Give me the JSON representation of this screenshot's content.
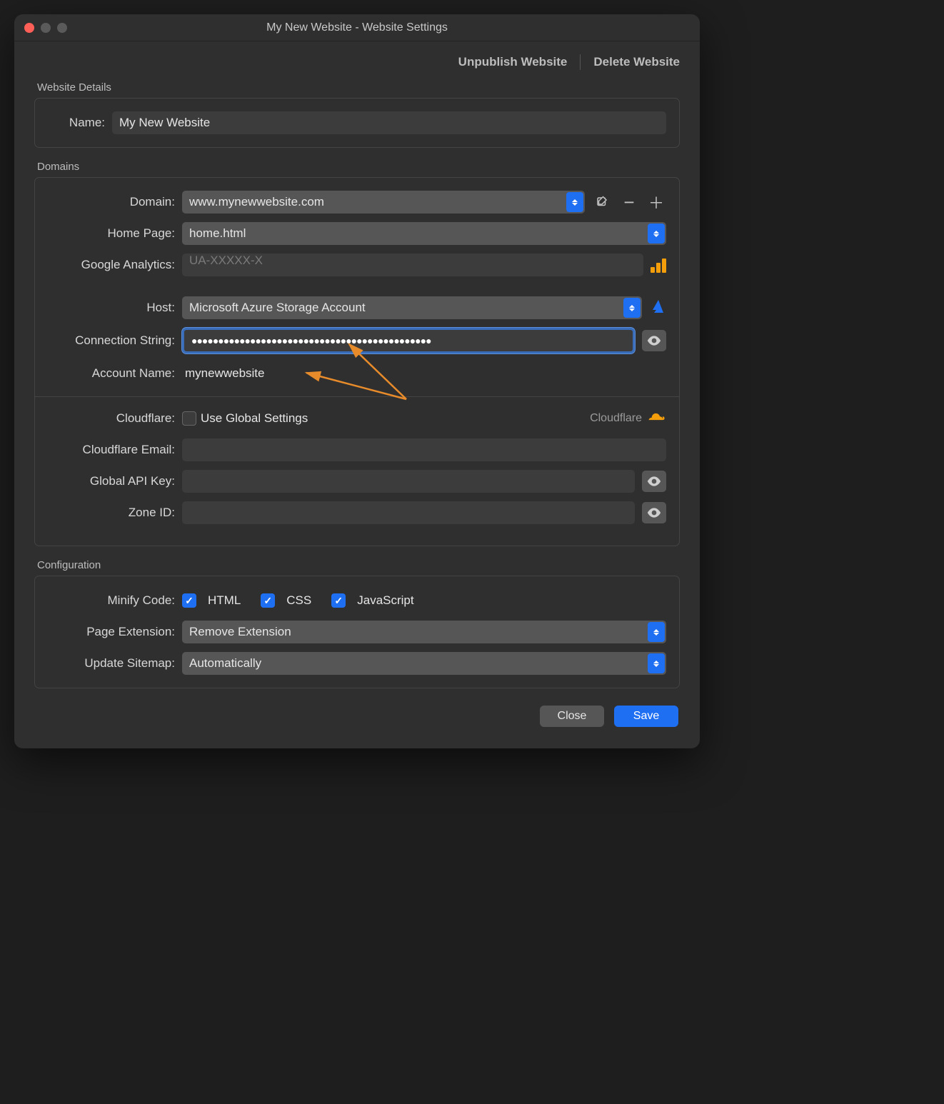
{
  "window": {
    "title": "My New Website - Website Settings"
  },
  "topActions": {
    "unpublish": "Unpublish Website",
    "delete": "Delete Website"
  },
  "sections": {
    "details": {
      "legend": "Website Details"
    },
    "domains": {
      "legend": "Domains"
    },
    "config": {
      "legend": "Configuration"
    }
  },
  "details": {
    "nameLabel": "Name:",
    "nameValue": "My New Website"
  },
  "domains": {
    "domainLabel": "Domain:",
    "domainValue": "www.mynewwebsite.com",
    "homePageLabel": "Home Page:",
    "homePageValue": "home.html",
    "gaLabel": "Google Analytics:",
    "gaPlaceholder": "UA-XXXXX-X",
    "hostLabel": "Host:",
    "hostValue": "Microsoft Azure Storage Account",
    "connLabel": "Connection String:",
    "connMask": "●●●●●●●●●●●●●●●●●●●●●●●●●●●●●●●●●●●●●●●●●●●●●",
    "acctLabel": "Account Name:",
    "acctValue": "mynewwebsite",
    "cfLabel": "Cloudflare:",
    "cfUseGlobal": "Use Global Settings",
    "cfBrand": "Cloudflare",
    "cfEmailLabel": "Cloudflare Email:",
    "cfApiLabel": "Global API Key:",
    "cfZoneLabel": "Zone ID:"
  },
  "config": {
    "minifyLabel": "Minify Code:",
    "minifyHtml": "HTML",
    "minifyCss": "CSS",
    "minifyJs": "JavaScript",
    "pageExtLabel": "Page Extension:",
    "pageExtValue": "Remove Extension",
    "sitemapLabel": "Update Sitemap:",
    "sitemapValue": "Automatically"
  },
  "footer": {
    "close": "Close",
    "save": "Save"
  }
}
